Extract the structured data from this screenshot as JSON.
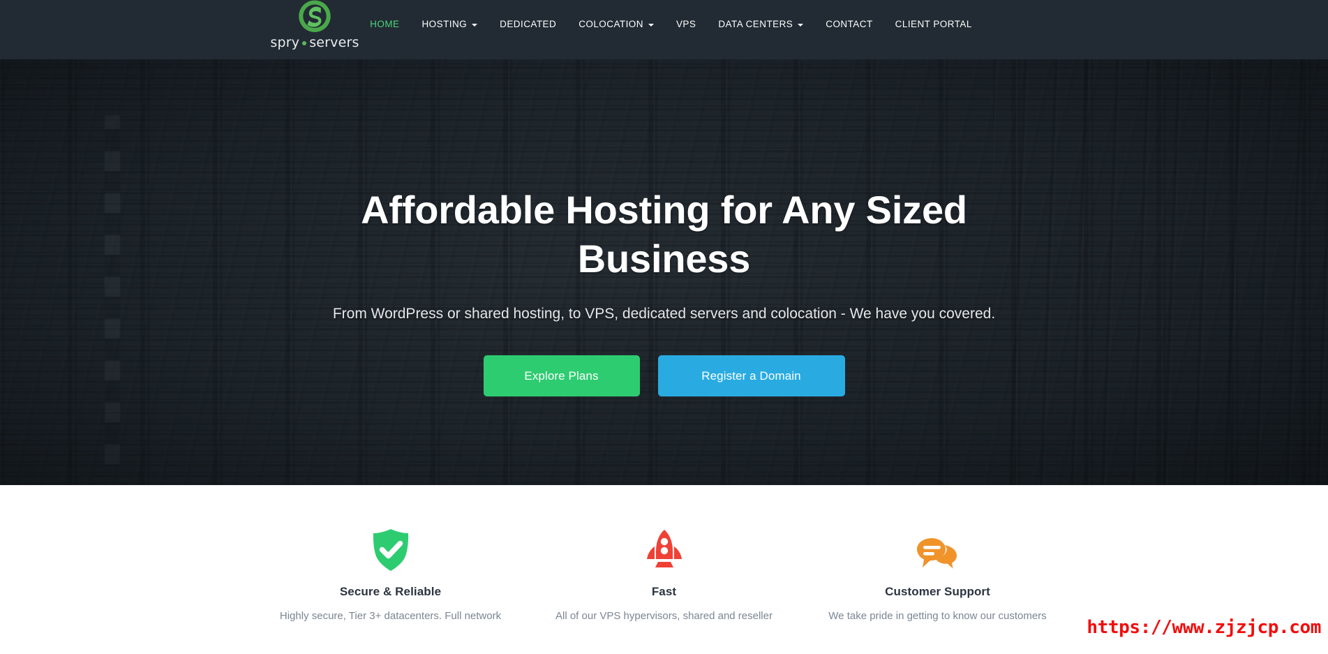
{
  "header": {
    "brand": {
      "name_part1": "spry",
      "name_part2": "servers",
      "logo_color": "#5cb85c",
      "background": "#222b33"
    },
    "nav": [
      {
        "label": "HOME",
        "active": true,
        "has_dropdown": false
      },
      {
        "label": "HOSTING",
        "active": false,
        "has_dropdown": true
      },
      {
        "label": "DEDICATED",
        "active": false,
        "has_dropdown": false
      },
      {
        "label": "COLOCATION",
        "active": false,
        "has_dropdown": true
      },
      {
        "label": "VPS",
        "active": false,
        "has_dropdown": false
      },
      {
        "label": "DATA CENTERS",
        "active": false,
        "has_dropdown": true
      },
      {
        "label": "CONTACT",
        "active": false,
        "has_dropdown": false
      },
      {
        "label": "CLIENT PORTAL",
        "active": false,
        "has_dropdown": false
      }
    ],
    "active_color": "#4cd47d"
  },
  "hero": {
    "title": "Affordable Hosting for Any Sized Business",
    "subtitle": "From WordPress or shared hosting, to VPS, dedicated servers and colocation - We have you covered.",
    "primary_button": "Explore Plans",
    "secondary_button": "Register a Domain",
    "primary_color": "#2ecc71",
    "secondary_color": "#29abe2"
  },
  "features": [
    {
      "icon": "shield-check-icon",
      "icon_color": "#2ecc71",
      "title": "Secure & Reliable",
      "description": "Highly secure, Tier 3+ datacenters. Full network"
    },
    {
      "icon": "rocket-icon",
      "icon_color": "#ef4136",
      "title": "Fast",
      "description": "All of our VPS hypervisors, shared and reseller"
    },
    {
      "icon": "chat-bubbles-icon",
      "icon_color": "#f0932b",
      "title": "Customer Support",
      "description": "We take pride in getting to know our customers"
    }
  ],
  "watermark": {
    "text": "https://www.zjzjcp.com",
    "color": "#f20d0d"
  }
}
